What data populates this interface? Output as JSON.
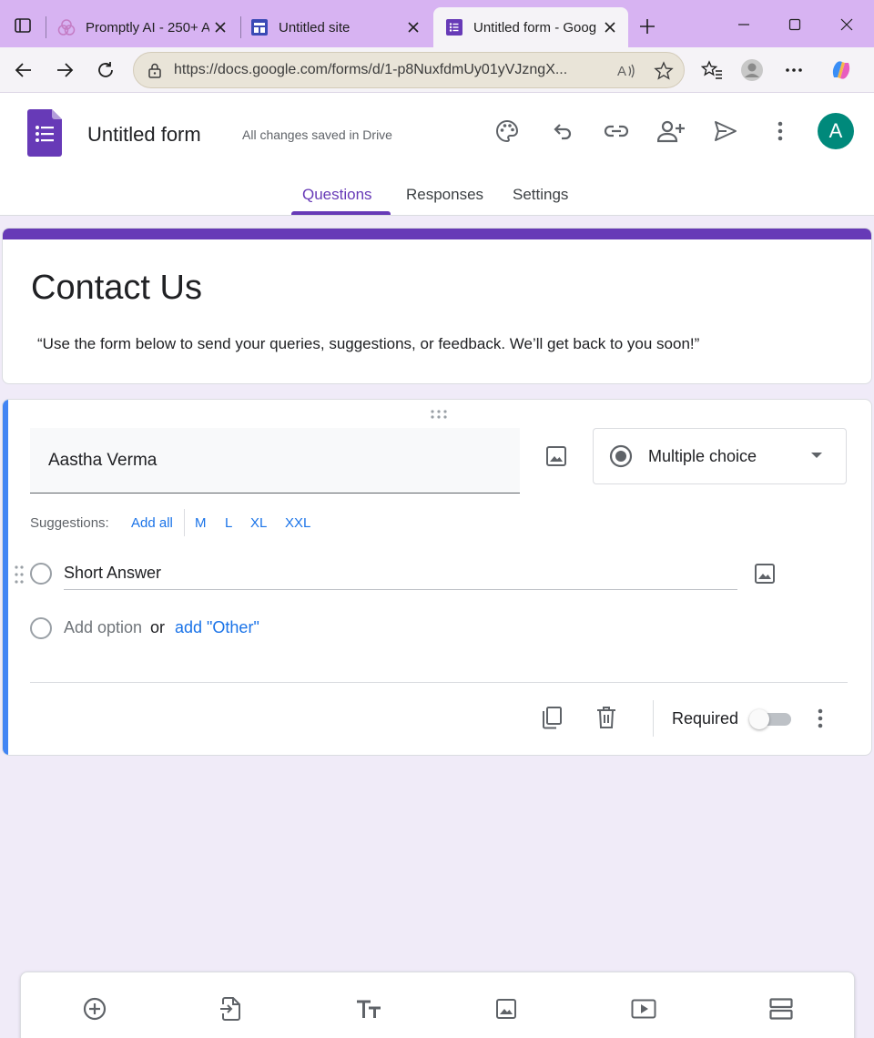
{
  "browser": {
    "tabs": [
      {
        "title": "Promptly AI - 250+ A"
      },
      {
        "title": "Untitled site"
      },
      {
        "title": "Untitled form - Goog"
      }
    ],
    "url": "https://docs.google.com/forms/d/1-p8NuxfdmUy01yVJzngX..."
  },
  "header": {
    "form_title": "Untitled form",
    "save_status": "All changes saved in Drive",
    "avatar_initial": "A",
    "tabs": [
      "Questions",
      "Responses",
      "Settings"
    ],
    "active_tab": "Questions"
  },
  "title_card": {
    "heading": "Contact Us",
    "description": "“Use the form below to send your queries, suggestions, or feedback. We’ll get back to you soon!”"
  },
  "question": {
    "title_value": "Aastha Verma",
    "type": "Multiple choice",
    "suggestions_label": "Suggestions:",
    "suggestions": [
      "Add all",
      "M",
      "L",
      "XL",
      "XXL"
    ],
    "options": [
      "Short Answer"
    ],
    "add_option": "Add option",
    "or": "or",
    "add_other": "add \"Other\"",
    "required_label": "Required",
    "required": false
  },
  "colors": {
    "accent": "#673ab7",
    "tabstrip": "#d7b3f2",
    "link": "#1a73e8",
    "active_bar": "#4285f4",
    "avatar": "#00897b"
  },
  "bottom_toolbar": [
    "add-question-icon",
    "import-questions-icon",
    "add-title-icon",
    "add-image-icon",
    "add-video-icon",
    "add-section-icon"
  ]
}
